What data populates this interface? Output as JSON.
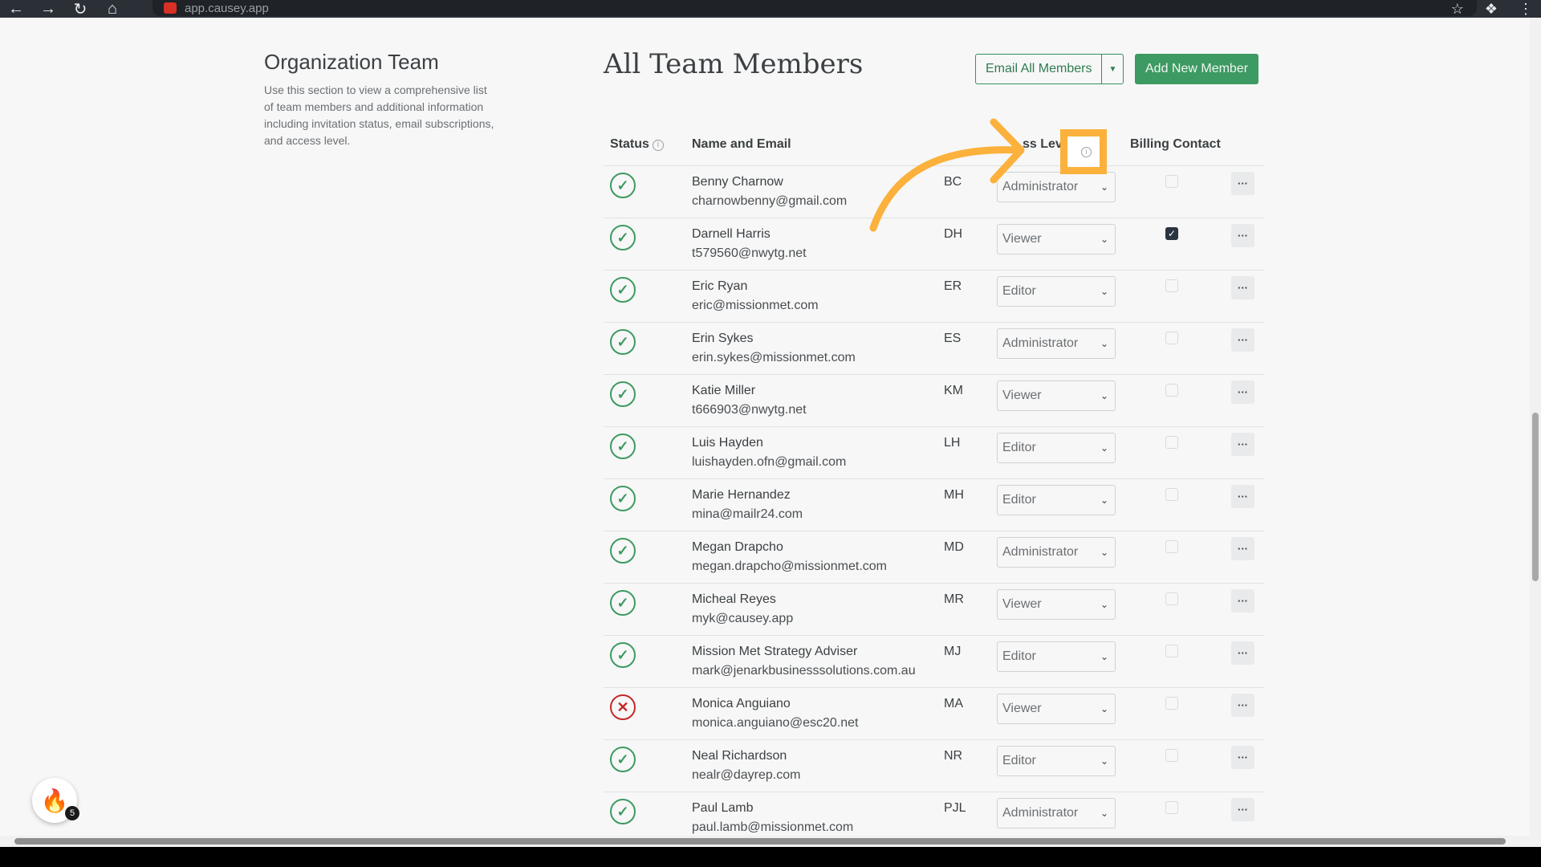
{
  "browser": {
    "url": "app.causey.app",
    "back_icon": "arrow-left-icon",
    "forward_icon": "arrow-right-icon",
    "reload_icon": "reload-icon",
    "home_icon": "home-icon"
  },
  "sidebar": {
    "title": "Organization Team",
    "description": "Use this section to view a comprehensive list of team members and additional information including invitation status, email subscriptions, and access level."
  },
  "header": {
    "title": "All Team Members",
    "email_all_label": "Email All Members",
    "add_member_label": "Add New Member"
  },
  "table": {
    "columns": {
      "status": "Status",
      "name_email": "Name and Email",
      "access_level_partial": "ss Level",
      "billing_contact": "Billing Contact"
    },
    "rows": [
      {
        "status": "active",
        "name": "Benny Charnow",
        "email": "charnowbenny@gmail.com",
        "initials": "BC",
        "access": "Administrator",
        "billing": false
      },
      {
        "status": "active",
        "name": "Darnell Harris",
        "email": "t579560@nwytg.net",
        "initials": "DH",
        "access": "Viewer",
        "billing": true
      },
      {
        "status": "active",
        "name": "Eric Ryan",
        "email": "eric@missionmet.com",
        "initials": "ER",
        "access": "Editor",
        "billing": false
      },
      {
        "status": "active",
        "name": "Erin Sykes",
        "email": "erin.sykes@missionmet.com",
        "initials": "ES",
        "access": "Administrator",
        "billing": false
      },
      {
        "status": "active",
        "name": "Katie Miller",
        "email": "t666903@nwytg.net",
        "initials": "KM",
        "access": "Viewer",
        "billing": false
      },
      {
        "status": "active",
        "name": "Luis Hayden",
        "email": "luishayden.ofn@gmail.com",
        "initials": "LH",
        "access": "Editor",
        "billing": false
      },
      {
        "status": "active",
        "name": "Marie Hernandez",
        "email": "mina@mailr24.com",
        "initials": "MH",
        "access": "Editor",
        "billing": false
      },
      {
        "status": "active",
        "name": "Megan Drapcho",
        "email": "megan.drapcho@missionmet.com",
        "initials": "MD",
        "access": "Administrator",
        "billing": false
      },
      {
        "status": "active",
        "name": "Micheal Reyes",
        "email": "myk@causey.app",
        "initials": "MR",
        "access": "Viewer",
        "billing": false
      },
      {
        "status": "active",
        "name": "Mission Met Strategy Adviser",
        "email": "mark@jenarkbusinesssolutions.com.au",
        "initials": "MJ",
        "access": "Editor",
        "billing": false
      },
      {
        "status": "inactive",
        "name": "Monica Anguiano",
        "email": "monica.anguiano@esc20.net",
        "initials": "MA",
        "access": "Viewer",
        "billing": false
      },
      {
        "status": "active",
        "name": "Neal Richardson",
        "email": "nealr@dayrep.com",
        "initials": "NR",
        "access": "Editor",
        "billing": false
      },
      {
        "status": "active",
        "name": "Paul Lamb",
        "email": "paul.lamb@missionmet.com",
        "initials": "PJL",
        "access": "Administrator",
        "billing": false
      }
    ]
  },
  "notification_badge": {
    "icon": "fire-icon",
    "count": "5"
  },
  "colors": {
    "accent_green": "#3d9a62",
    "highlight_orange": "#fbb13c",
    "error_red": "#c62828"
  }
}
